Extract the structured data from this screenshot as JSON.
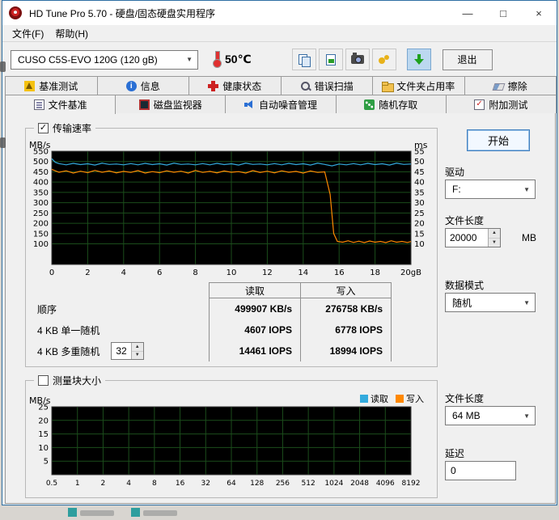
{
  "window": {
    "title": "HD Tune Pro 5.70 - 硬盘/固态硬盘实用程序",
    "minimize": "—",
    "maximize": "□",
    "close": "×"
  },
  "menu": {
    "file": "文件(F)",
    "help": "帮助(H)"
  },
  "toolbar": {
    "drive_select": "CUSO C5S-EVO 120G (120 gB)",
    "temperature": "50℃",
    "exit": "退出"
  },
  "tabs": {
    "row1": [
      {
        "label": "基准测试"
      },
      {
        "label": "信息"
      },
      {
        "label": "健康状态"
      },
      {
        "label": "错误扫描"
      },
      {
        "label": "文件夹占用率"
      },
      {
        "label": "擦除"
      }
    ],
    "row2": [
      {
        "label": "文件基准"
      },
      {
        "label": "磁盘监视器"
      },
      {
        "label": "自动噪音管理"
      },
      {
        "label": "随机存取"
      },
      {
        "label": "附加测试"
      }
    ],
    "active": "文件基准"
  },
  "file_benchmark": {
    "transfer_rate_label": "传输速率",
    "results": {
      "read_header": "读取",
      "write_header": "写入",
      "rows": [
        {
          "label": "顺序",
          "read": "499907 KB/s",
          "write": "276758 KB/s"
        },
        {
          "label": "4 KB 单一随机",
          "read": "4607 IOPS",
          "write": "6778 IOPS"
        },
        {
          "label": "4 KB 多重随机",
          "queue_depth": "32",
          "read": "14461 IOPS",
          "write": "18994 IOPS"
        }
      ]
    },
    "controls": {
      "start": "开始",
      "drive_label": "驱动",
      "drive": "F:",
      "file_length_label": "文件长度",
      "file_length": "20000",
      "file_length_unit": "MB",
      "data_mode_label": "数据模式",
      "data_mode": "随机"
    }
  },
  "block_size": {
    "label": "测量块大小",
    "legend": {
      "read": "读取",
      "read_color": "#33aadd",
      "write": "写入",
      "write_color": "#ff8800"
    },
    "controls": {
      "file_length_label": "文件长度",
      "file_length": "64 MB",
      "delay_label": "延迟",
      "delay": "0"
    }
  },
  "chart_data": [
    {
      "id": "transfer_rate",
      "type": "line",
      "plot_bg": "#000000",
      "grid_color": "#1b4d1b",
      "left_axis_label": "MB/s",
      "right_axis_label": "ms",
      "left_ticks": [
        550,
        500,
        450,
        400,
        350,
        300,
        250,
        200,
        150,
        100
      ],
      "left_max": 550,
      "right_ticks": [
        55,
        50,
        45,
        40,
        35,
        30,
        25,
        20,
        15,
        10
      ],
      "right_max": 55,
      "x_ticks": [
        "0",
        "2",
        "4",
        "6",
        "8",
        "10",
        "12",
        "14",
        "16",
        "18",
        "20gB"
      ],
      "x_max": 20,
      "series": [
        {
          "name": "读取",
          "color": "#33aadd",
          "points": [
            [
              0,
              514
            ],
            [
              0.2,
              496
            ],
            [
              0.4,
              490
            ],
            [
              0.8,
              484
            ],
            [
              1.2,
              491
            ],
            [
              1.6,
              485
            ],
            [
              2,
              489
            ],
            [
              2.4,
              483
            ],
            [
              2.8,
              492
            ],
            [
              3.2,
              486
            ],
            [
              3.6,
              488
            ],
            [
              4,
              484
            ],
            [
              4.4,
              490
            ],
            [
              4.8,
              484
            ],
            [
              5.2,
              491
            ],
            [
              5.6,
              485
            ],
            [
              6,
              489
            ],
            [
              6.4,
              483
            ],
            [
              6.8,
              492
            ],
            [
              7.2,
              486
            ],
            [
              7.6,
              488
            ],
            [
              8,
              484
            ],
            [
              8.4,
              490
            ],
            [
              8.8,
              484
            ],
            [
              9.2,
              491
            ],
            [
              9.6,
              485
            ],
            [
              10,
              489
            ],
            [
              10.4,
              483
            ],
            [
              10.8,
              492
            ],
            [
              11.2,
              486
            ],
            [
              11.6,
              488
            ],
            [
              12,
              484
            ],
            [
              12.4,
              490
            ],
            [
              12.8,
              484
            ],
            [
              13.2,
              491
            ],
            [
              13.6,
              485
            ],
            [
              14,
              489
            ],
            [
              14.4,
              483
            ],
            [
              14.8,
              492
            ],
            [
              15.2,
              486
            ],
            [
              15.6,
              479
            ],
            [
              16,
              488
            ],
            [
              16.4,
              484
            ],
            [
              16.8,
              490
            ],
            [
              17.2,
              484
            ],
            [
              17.6,
              491
            ],
            [
              18,
              485
            ],
            [
              18.4,
              489
            ],
            [
              18.8,
              483
            ],
            [
              19.2,
              492
            ],
            [
              19.6,
              486
            ],
            [
              20,
              488
            ]
          ]
        },
        {
          "name": "写入",
          "color": "#ff8800",
          "points": [
            [
              0,
              462
            ],
            [
              0.4,
              448
            ],
            [
              0.8,
              455
            ],
            [
              1.2,
              444
            ],
            [
              1.6,
              453
            ],
            [
              2,
              446
            ],
            [
              2.4,
              457
            ],
            [
              2.8,
              448
            ],
            [
              3.2,
              454
            ],
            [
              3.6,
              445
            ],
            [
              4,
              452
            ],
            [
              4.4,
              447
            ],
            [
              4.8,
              456
            ],
            [
              5.2,
              444
            ],
            [
              5.6,
              451
            ],
            [
              6,
              446
            ],
            [
              6.4,
              455
            ],
            [
              6.8,
              448
            ],
            [
              7.2,
              453
            ],
            [
              7.6,
              444
            ],
            [
              8,
              457
            ],
            [
              8.4,
              447
            ],
            [
              8.8,
              452
            ],
            [
              9.2,
              445
            ],
            [
              9.6,
              454
            ],
            [
              10,
              448
            ],
            [
              10.4,
              451
            ],
            [
              10.8,
              444
            ],
            [
              11.2,
              456
            ],
            [
              11.6,
              447
            ],
            [
              12,
              453
            ],
            [
              12.4,
              445
            ],
            [
              12.8,
              455
            ],
            [
              13.2,
              448
            ],
            [
              13.6,
              452
            ],
            [
              14,
              444
            ],
            [
              14.4,
              454
            ],
            [
              14.8,
              447
            ],
            [
              15.2,
              450
            ],
            [
              15.5,
              340
            ],
            [
              15.7,
              150
            ],
            [
              15.9,
              112
            ],
            [
              16.2,
              108
            ],
            [
              16.5,
              115
            ],
            [
              16.8,
              107
            ],
            [
              17.1,
              113
            ],
            [
              17.4,
              106
            ],
            [
              17.7,
              114
            ],
            [
              18,
              108
            ],
            [
              18.3,
              112
            ],
            [
              18.6,
              106
            ],
            [
              18.9,
              115
            ],
            [
              19.2,
              108
            ],
            [
              19.5,
              112
            ],
            [
              19.8,
              107
            ],
            [
              20,
              111
            ]
          ]
        }
      ]
    },
    {
      "id": "block_size",
      "type": "line",
      "plot_bg": "#000000",
      "grid_color": "#1b4d1b",
      "y_label": "MB/s",
      "y_ticks": [
        25,
        20,
        15,
        10,
        5
      ],
      "y_max": 25,
      "x_ticks": [
        "0.5",
        "1",
        "2",
        "4",
        "8",
        "16",
        "32",
        "64",
        "128",
        "256",
        "512",
        "1024",
        "2048",
        "4096",
        "8192"
      ],
      "series": []
    }
  ]
}
